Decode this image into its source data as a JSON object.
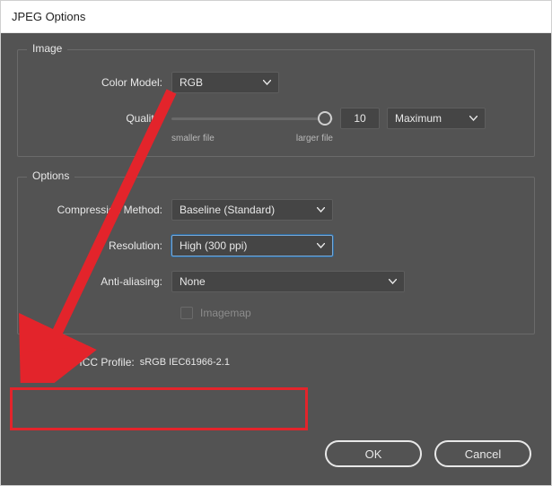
{
  "window": {
    "title": "JPEG Options"
  },
  "groups": {
    "image": {
      "legend": "Image",
      "color_model_label": "Color Model:",
      "color_model_value": "RGB",
      "quality_label": "Quality:",
      "quality_value": "10",
      "quality_preset": "Maximum",
      "slider_min_caption": "smaller file",
      "slider_max_caption": "larger file",
      "slider_percent": 95
    },
    "options": {
      "legend": "Options",
      "compression_label": "Compression Method:",
      "compression_value": "Baseline (Standard)",
      "resolution_label": "Resolution:",
      "resolution_value": "High (300 ppi)",
      "antialias_label": "Anti-aliasing:",
      "antialias_value": "None",
      "imagemap_label": "Imagemap",
      "imagemap_checked": false,
      "imagemap_enabled": false
    }
  },
  "icc": {
    "checked": true,
    "label": "Embed ICC Profile:",
    "value": "sRGB IEC61966-2.1"
  },
  "buttons": {
    "ok": "OK",
    "cancel": "Cancel"
  },
  "annotation": {
    "highlight_color": "#E3242B"
  }
}
